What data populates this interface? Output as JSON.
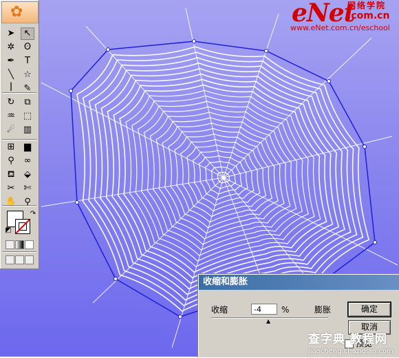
{
  "logo": {
    "brand": "eNet",
    "chinese": "网络学院",
    "domain": ".com.cn",
    "url": "www.eNet.com.cn/eschool"
  },
  "toolbox": {
    "header_icon": "flower-icon",
    "tools": [
      {
        "name": "selection-tool",
        "glyph": "➤"
      },
      {
        "name": "direct-selection-tool",
        "glyph": "↖"
      },
      {
        "name": "magic-wand-tool",
        "glyph": "✲"
      },
      {
        "name": "lasso-tool",
        "glyph": "ʘ"
      },
      {
        "name": "pen-tool",
        "glyph": "✒"
      },
      {
        "name": "type-tool",
        "glyph": "T"
      },
      {
        "name": "line-tool",
        "glyph": "╲"
      },
      {
        "name": "star-tool",
        "glyph": "☆"
      },
      {
        "name": "paintbrush-tool",
        "glyph": "ꟾ"
      },
      {
        "name": "pencil-tool",
        "glyph": "✎"
      },
      {
        "name": "rotate-tool",
        "glyph": "↻"
      },
      {
        "name": "scale-tool",
        "glyph": "⧉"
      },
      {
        "name": "warp-tool",
        "glyph": "♒"
      },
      {
        "name": "free-transform-tool",
        "glyph": "⬚"
      },
      {
        "name": "symbol-sprayer-tool",
        "glyph": "☄"
      },
      {
        "name": "column-graph-tool",
        "glyph": "▥"
      },
      {
        "name": "mesh-tool",
        "glyph": "⊞"
      },
      {
        "name": "gradient-tool",
        "glyph": "▆"
      },
      {
        "name": "eyedropper-tool",
        "glyph": "⚲"
      },
      {
        "name": "blend-tool",
        "glyph": "∞"
      },
      {
        "name": "live-paint-bucket-tool",
        "glyph": "⛾"
      },
      {
        "name": "live-paint-selection-tool",
        "glyph": "⬙"
      },
      {
        "name": "slice-tool",
        "glyph": "✂"
      },
      {
        "name": "scissors-tool",
        "glyph": "✄"
      },
      {
        "name": "hand-tool",
        "glyph": "✋"
      },
      {
        "name": "zoom-tool",
        "glyph": "⚲"
      }
    ]
  },
  "dialog": {
    "title": "收缩和膨胀",
    "left_label": "收缩",
    "value": "-4",
    "unit": "%",
    "right_label": "膨胀",
    "ok_label": "确定",
    "cancel_label": "取消",
    "preview_label": "预览"
  },
  "watermark": {
    "main": "查字典 教程网",
    "sub": "jiaocheng.chazidian.com"
  },
  "colors": {
    "accent_red": "#d40000",
    "web_outline": "#1f1fd8",
    "web_thread": "#ffffff"
  }
}
